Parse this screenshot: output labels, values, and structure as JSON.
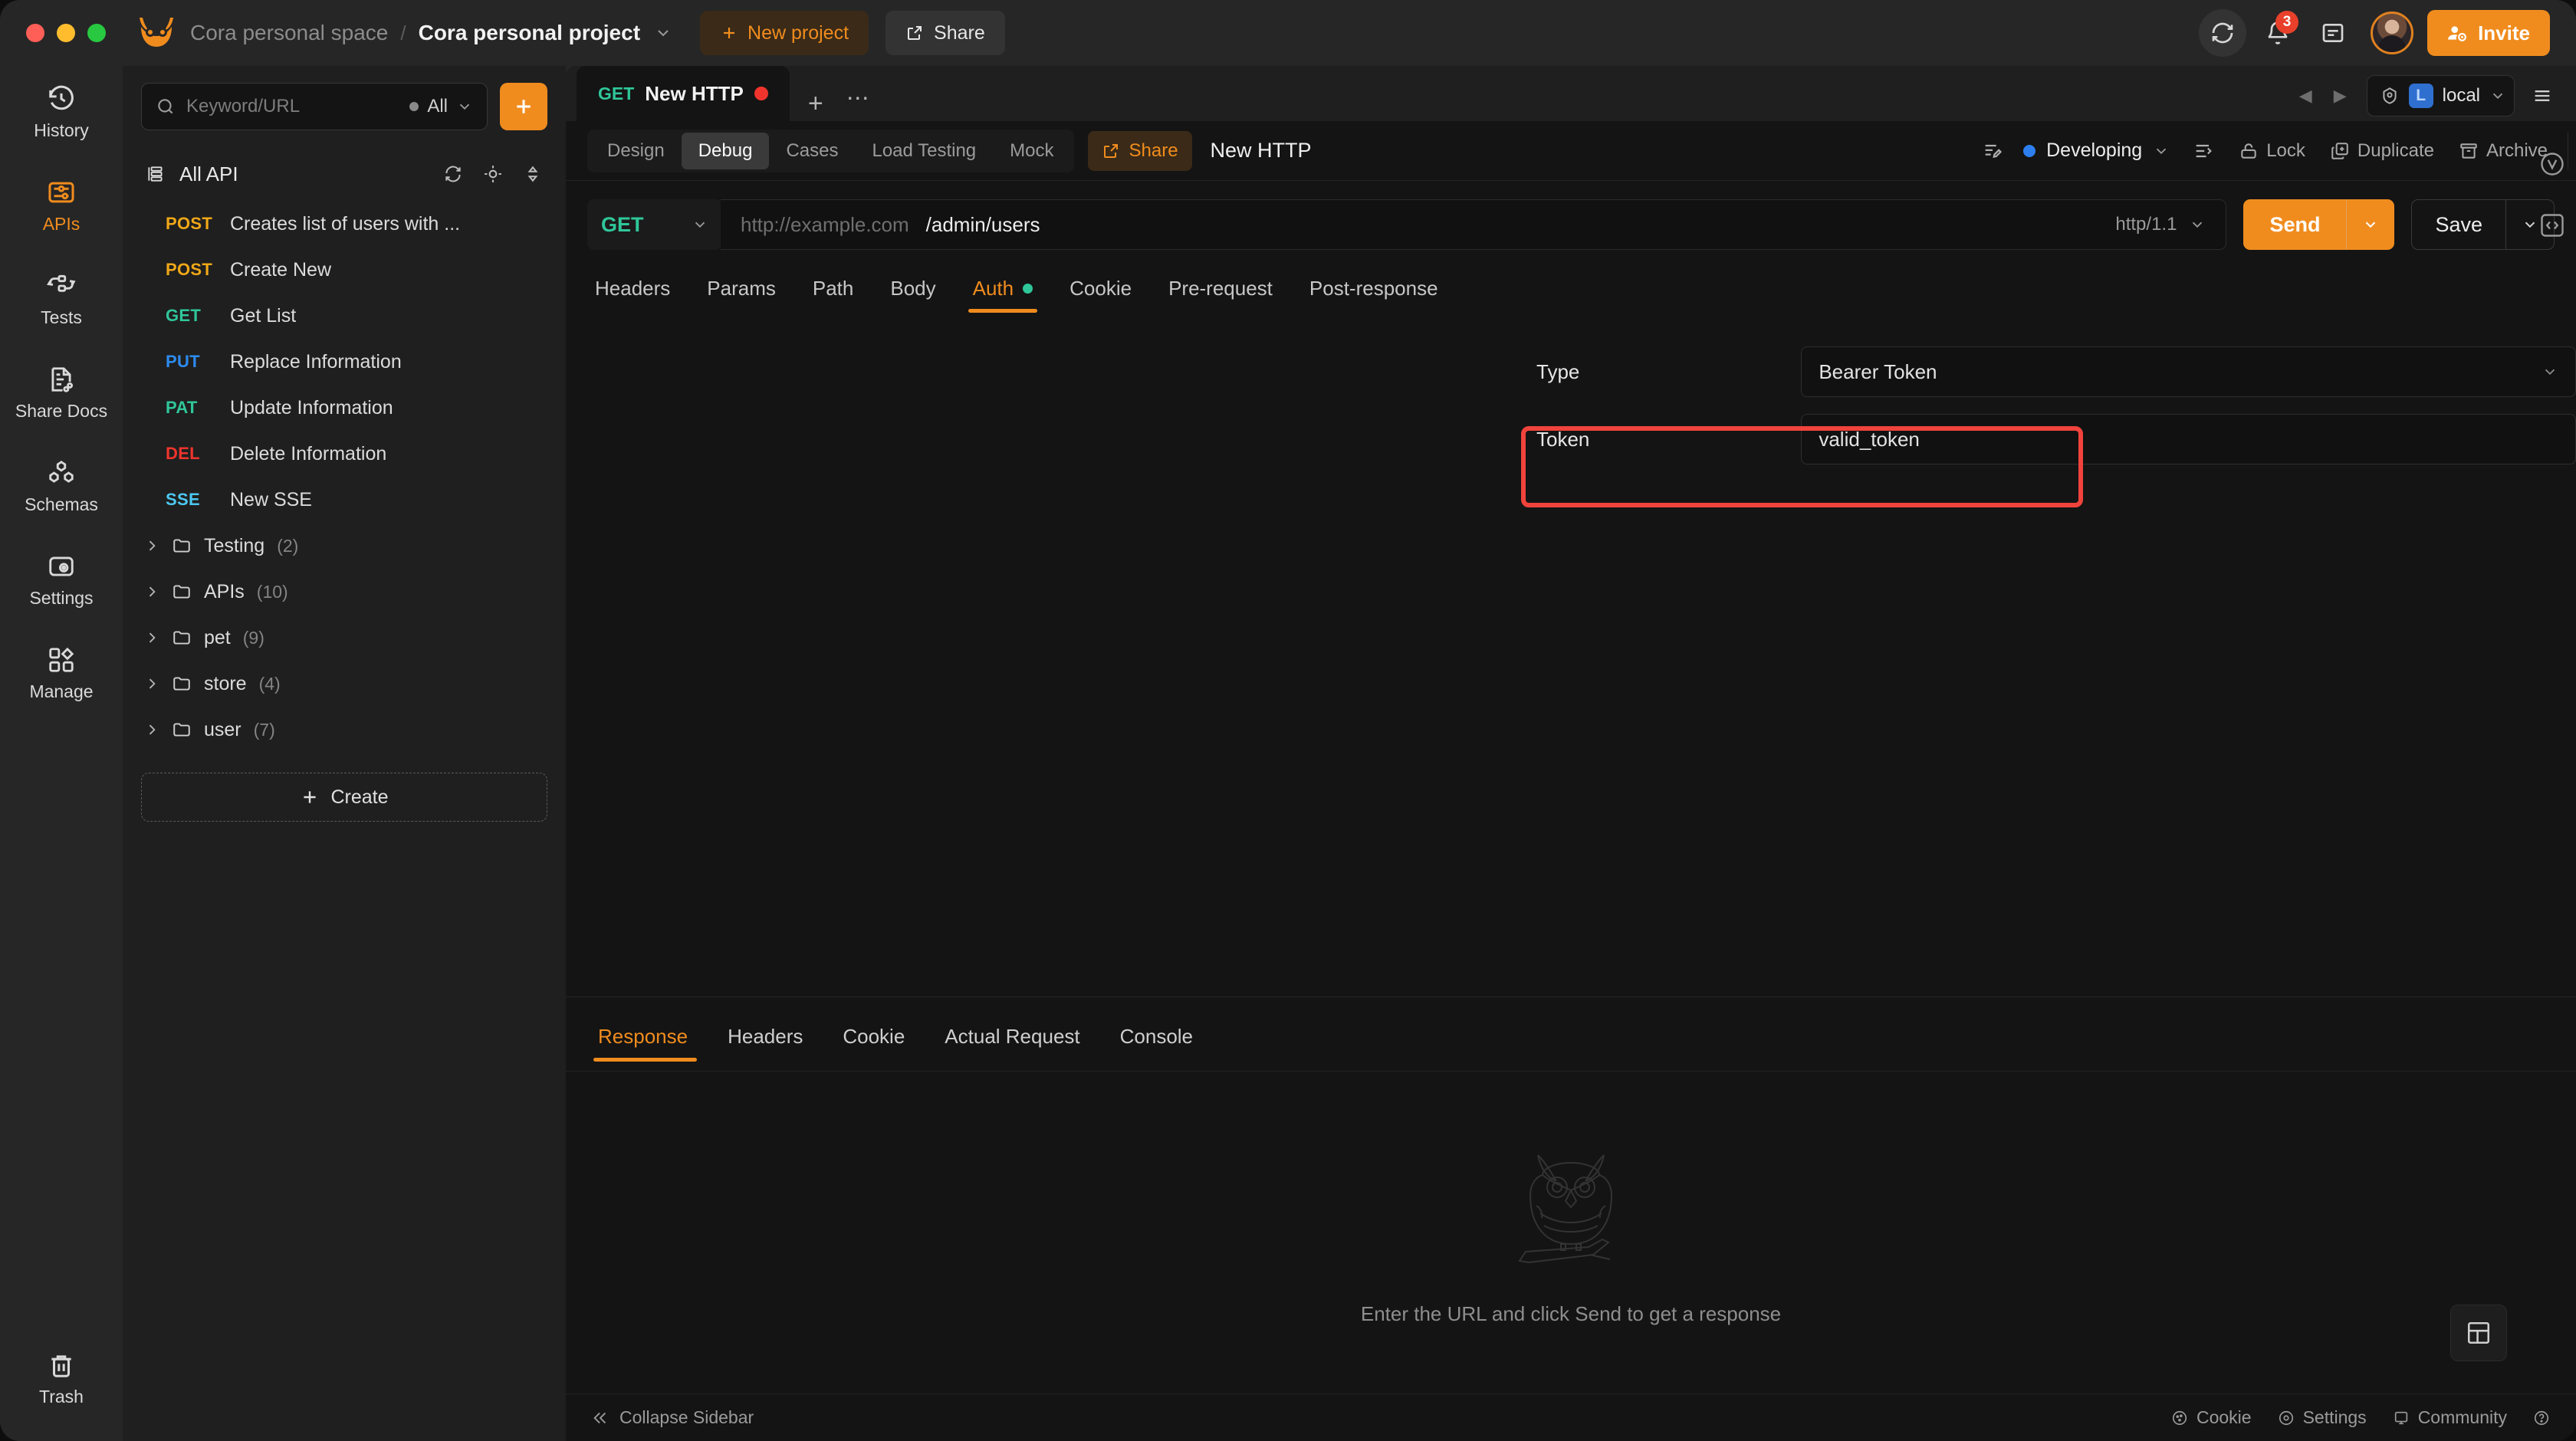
{
  "titlebar": {
    "logo_icon": "owl-logo-icon",
    "breadcrumb_space": "Cora personal space",
    "breadcrumb_separator": "/",
    "breadcrumb_project": "Cora personal project",
    "new_project_label": "New project",
    "share_label": "Share",
    "notification_count": "3",
    "invite_label": "Invite"
  },
  "rail": {
    "items": [
      {
        "label": "History",
        "icon": "history-icon",
        "active": false
      },
      {
        "label": "APIs",
        "icon": "apis-icon",
        "active": true
      },
      {
        "label": "Tests",
        "icon": "tests-icon",
        "active": false
      },
      {
        "label": "Share Docs",
        "icon": "share-docs-icon",
        "active": false
      },
      {
        "label": "Schemas",
        "icon": "schemas-icon",
        "active": false
      },
      {
        "label": "Settings",
        "icon": "settings-icon",
        "active": false
      },
      {
        "label": "Manage",
        "icon": "manage-icon",
        "active": false
      }
    ],
    "trash_label": "Trash"
  },
  "sidebar": {
    "search_placeholder": "Keyword/URL",
    "filter_label": "All",
    "add_button_icon": "plus-icon",
    "all_api_label": "All API",
    "apis": [
      {
        "method": "POST",
        "name": "Creates list of users with ...",
        "cls": "m-post"
      },
      {
        "method": "POST",
        "name": "Create New",
        "cls": "m-post"
      },
      {
        "method": "GET",
        "name": "Get List",
        "cls": "m-get"
      },
      {
        "method": "PUT",
        "name": "Replace Information",
        "cls": "m-put"
      },
      {
        "method": "PAT",
        "name": "Update Information",
        "cls": "m-pat"
      },
      {
        "method": "DEL",
        "name": "Delete Information",
        "cls": "m-del"
      },
      {
        "method": "SSE",
        "name": "New SSE",
        "cls": "m-sse"
      }
    ],
    "folders": [
      {
        "name": "Testing",
        "count": "(2)"
      },
      {
        "name": "APIs",
        "count": "(10)"
      },
      {
        "name": "pet",
        "count": "(9)"
      },
      {
        "name": "store",
        "count": "(4)"
      },
      {
        "name": "user",
        "count": "(7)"
      }
    ],
    "create_label": "Create"
  },
  "doc_tab": {
    "method": "GET",
    "name": "New HTTP",
    "unsaved": true
  },
  "env": {
    "badge": "L",
    "name": "local"
  },
  "toolbar": {
    "modes": [
      {
        "label": "Design",
        "active": false
      },
      {
        "label": "Debug",
        "active": true
      },
      {
        "label": "Cases",
        "active": false
      },
      {
        "label": "Load Testing",
        "active": false
      },
      {
        "label": "Mock",
        "active": false
      }
    ],
    "share_label": "Share",
    "doc_title": "New HTTP",
    "status_label": "Developing",
    "status_color": "#2d7ff0",
    "lock_label": "Lock",
    "duplicate_label": "Duplicate",
    "archive_label": "Archive"
  },
  "request": {
    "method": "GET",
    "url_host_placeholder": "http://example.com",
    "url_path": "/admin/users",
    "protocol": "http/1.1",
    "send_label": "Send",
    "save_label": "Save",
    "tabs": [
      {
        "label": "Headers",
        "active": false,
        "dot": false
      },
      {
        "label": "Params",
        "active": false,
        "dot": false
      },
      {
        "label": "Path",
        "active": false,
        "dot": false
      },
      {
        "label": "Body",
        "active": false,
        "dot": false
      },
      {
        "label": "Auth",
        "active": true,
        "dot": true
      },
      {
        "label": "Cookie",
        "active": false,
        "dot": false
      },
      {
        "label": "Pre-request",
        "active": false,
        "dot": false
      },
      {
        "label": "Post-response",
        "active": false,
        "dot": false
      }
    ]
  },
  "auth": {
    "type_label": "Type",
    "type_value": "Bearer Token",
    "token_label": "Token",
    "token_value": "valid_token",
    "highlight_color": "#f0433c"
  },
  "response": {
    "tabs": [
      {
        "label": "Response",
        "active": true
      },
      {
        "label": "Headers",
        "active": false
      },
      {
        "label": "Cookie",
        "active": false
      },
      {
        "label": "Actual Request",
        "active": false
      },
      {
        "label": "Console",
        "active": false
      }
    ],
    "empty_caption": "Enter the URL and click Send to get a response",
    "empty_icon": "owl-illustration-icon"
  },
  "statusbar": {
    "collapse_label": "Collapse Sidebar",
    "cookie_label": "Cookie",
    "settings_label": "Settings",
    "community_label": "Community"
  }
}
